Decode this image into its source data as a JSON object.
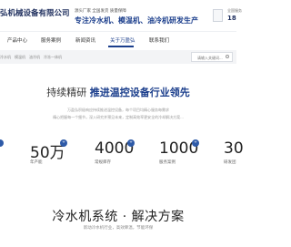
{
  "header": {
    "logo_text": "弘机械设备有限公司",
    "tagline_small": "源头厂家 全国发货 质量保障",
    "tagline_big": "专注冷水机、模温机、油冷机研发生产",
    "hotline_label": "全国服务",
    "hotline_number": "18"
  },
  "nav": {
    "items": [
      "产品中心",
      "服务案例",
      "新闻资讯",
      "关于万盈弘",
      "联系我们"
    ],
    "active_index": 3
  },
  "breadcrumb": "冷水机　模温机　油冷机　冷冻一体机",
  "search": {
    "placeholder": "请输入关键词..."
  },
  "hero": {
    "headline_light": "持续精研",
    "headline_bold": "推进温控设备行业领先",
    "desc_line1": "万盈弘积极响应持续推进温控设备，每个项目均精心服务每需求",
    "desc_line2": "精心把握每一个细节，深入研究并预见未来，定制高效率更安全的冷却解决方案..."
  },
  "stats": [
    {
      "value": "50万",
      "badge": "+",
      "label": "年产能"
    },
    {
      "value": "4000",
      "badge": "+",
      "label": "常规库存"
    },
    {
      "value": "1000",
      "badge": "+",
      "label": "服务案例"
    },
    {
      "value": "30",
      "badge": "",
      "label": "研发团"
    }
  ],
  "section": {
    "title": "冷水机系统 · 解决方案",
    "subtitle": "新动冷水机行业，高效降温，节能环保"
  },
  "colors": {
    "brand": "#1b3e8c",
    "accent": "#2e5aa8"
  }
}
